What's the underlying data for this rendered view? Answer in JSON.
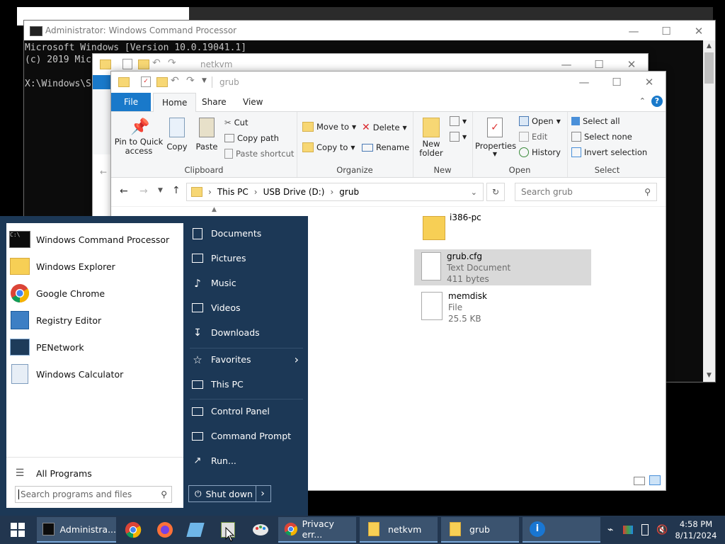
{
  "cmd": {
    "title": "Administrator: Windows Command Processor",
    "lines": [
      "Microsoft Windows [Version 10.0.19041.1]",
      "(c) 2019 Mic",
      "",
      "X:\\Windows\\S"
    ]
  },
  "back_explorer": {
    "title": "netkvm"
  },
  "explorer": {
    "title": "grub",
    "tabs": [
      "File",
      "Home",
      "Share",
      "View"
    ],
    "ribbon": {
      "clipboard": {
        "pin": "Pin to Quick access",
        "copy": "Copy",
        "paste": "Paste",
        "cut": "Cut",
        "copy_path": "Copy path",
        "paste_shortcut": "Paste shortcut",
        "label": "Clipboard"
      },
      "organize": {
        "move_to": "Move to",
        "copy_to": "Copy to",
        "delete": "Delete",
        "rename": "Rename",
        "label": "Organize"
      },
      "new": {
        "new_folder": "New folder",
        "label": "New"
      },
      "open": {
        "properties": "Properties",
        "open": "Open",
        "edit": "Edit",
        "history": "History",
        "label": "Open"
      },
      "select": {
        "select_all": "Select all",
        "select_none": "Select none",
        "invert": "Invert selection",
        "label": "Select"
      }
    },
    "address": {
      "crumbs": [
        "This PC",
        "USB Drive (D:)",
        "grub"
      ],
      "search_placeholder": "Search grub"
    },
    "files": [
      {
        "name": "i386-pc",
        "type": "",
        "size": "",
        "icon": "folder-icon"
      },
      {
        "name": "grub.cfg",
        "type": "Text Document",
        "size": "411 bytes",
        "icon": "text-document-icon"
      },
      {
        "name": "memdisk",
        "type": "File",
        "size": "25.5 KB",
        "icon": "file-icon"
      }
    ],
    "selected_file": "grub.cfg"
  },
  "start_menu": {
    "programs": [
      "Windows Command Processor",
      "Windows Explorer",
      "Google Chrome",
      "Registry Editor",
      "PENetwork",
      "Windows Calculator"
    ],
    "all_programs": "All Programs",
    "search_placeholder": "Search programs and files",
    "right_links": [
      "Documents",
      "Pictures",
      "Music",
      "Videos",
      "Downloads",
      "Favorites",
      "This PC",
      "Control Panel",
      "Command Prompt",
      "Run..."
    ],
    "shutdown": "Shut down"
  },
  "taskbar": {
    "items": [
      "Administra...",
      "Privacy err...",
      "netkvm",
      "grub"
    ],
    "time": "4:58 PM",
    "date": "8/11/2024"
  },
  "colors": {
    "accent": "#1979ca",
    "start_bg": "#1c3856",
    "taskbar_bg": "#22364f",
    "selection": "#d9d9d9"
  }
}
